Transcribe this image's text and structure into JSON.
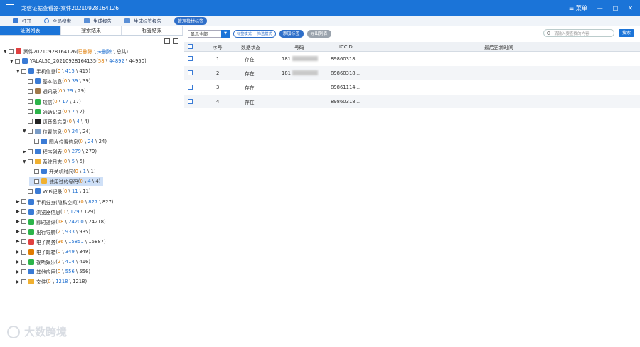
{
  "window": {
    "title": "龙信证据查看器-案件20210928164126",
    "menu_label": "菜单",
    "minimize": "—",
    "maximize": "□",
    "close": "✕"
  },
  "toolbar": {
    "items": [
      "打开",
      "全局搜索",
      "生成报告",
      "生成标签报告"
    ],
    "pill": "管理检材标签"
  },
  "left_tabs": [
    "证据列表",
    "搜索结果",
    "标签结果"
  ],
  "tree": [
    {
      "text": "案件20210928164126",
      "suffix_o": "已删除",
      "suffix_b": "未删除",
      "tail": "总共",
      "depth": 0,
      "arrow": "▼",
      "color": "#e04040"
    },
    {
      "text": "YALAL50_20210928164135",
      "n1": "58",
      "n2": "44892",
      "n3": "44950",
      "depth": 1,
      "arrow": "▼",
      "color": "#3a7bd5"
    },
    {
      "text": "手机信息",
      "n1": "0",
      "n2": "415",
      "n3": "415",
      "depth": 2,
      "arrow": "▼",
      "color": "#3a7bd5"
    },
    {
      "text": "基本信息",
      "n1": "0",
      "n2": "39",
      "n3": "39",
      "depth": 3,
      "arrow": "",
      "color": "#3a7bd5"
    },
    {
      "text": "通讯录",
      "n1": "0",
      "n2": "29",
      "n3": "29",
      "depth": 3,
      "arrow": "",
      "color": "#a0784a"
    },
    {
      "text": "短信",
      "n1": "0",
      "n2": "17",
      "n3": "17",
      "depth": 3,
      "arrow": "",
      "color": "#2cb44a"
    },
    {
      "text": "通话记录",
      "n1": "0",
      "n2": "7",
      "n3": "7",
      "depth": 3,
      "arrow": "",
      "color": "#2cb44a"
    },
    {
      "text": "语音备忘录",
      "n1": "0",
      "n2": "4",
      "n3": "4",
      "depth": 3,
      "arrow": "",
      "color": "#222222"
    },
    {
      "text": "位置信息",
      "n1": "0",
      "n2": "24",
      "n3": "24",
      "depth": 3,
      "arrow": "▼",
      "color": "#7a9cc6"
    },
    {
      "text": "图片位置信息",
      "n1": "0",
      "n2": "24",
      "n3": "24",
      "depth": 4,
      "arrow": "",
      "color": "#3a7bd5"
    },
    {
      "text": "程序列表",
      "n1": "0",
      "n2": "279",
      "n3": "279",
      "depth": 3,
      "arrow": "▶",
      "color": "#3a7bd5"
    },
    {
      "text": "系统日志",
      "n1": "0",
      "n2": "5",
      "n3": "5",
      "depth": 3,
      "arrow": "▼",
      "color": "#f0b030"
    },
    {
      "text": "开关机时间",
      "n1": "0",
      "n2": "1",
      "n3": "1",
      "depth": 4,
      "arrow": "",
      "color": "#3a7bd5"
    },
    {
      "text": "使用过的号码",
      "n1": "0",
      "n2": "4",
      "n3": "4",
      "depth": 4,
      "arrow": "",
      "color": "#f0b030",
      "selected": true
    },
    {
      "text": "WiFi记录",
      "n1": "0",
      "n2": "11",
      "n3": "11",
      "depth": 3,
      "arrow": "",
      "color": "#3a7bd5"
    },
    {
      "text": "手机分身(隐私空间)",
      "n1": "0",
      "n2": "827",
      "n3": "827",
      "depth": 2,
      "arrow": "▶",
      "color": "#3a7bd5"
    },
    {
      "text": "浏览器信息",
      "n1": "0",
      "n2": "129",
      "n3": "129",
      "depth": 2,
      "arrow": "▶",
      "color": "#3a7bd5"
    },
    {
      "text": "即时通讯",
      "n1": "18",
      "n2": "24200",
      "n3": "24218",
      "depth": 2,
      "arrow": "▶",
      "color": "#2cb44a"
    },
    {
      "text": "出行导航",
      "n1": "2",
      "n2": "933",
      "n3": "935",
      "depth": 2,
      "arrow": "▶",
      "color": "#2cb44a"
    },
    {
      "text": "电子商务",
      "n1": "36",
      "n2": "15851",
      "n3": "15887",
      "depth": 2,
      "arrow": "▶",
      "color": "#e04040"
    },
    {
      "text": "电子邮箱",
      "n1": "0",
      "n2": "349",
      "n3": "349",
      "depth": 2,
      "arrow": "▶",
      "color": "#e07b00"
    },
    {
      "text": "视听娱乐",
      "n1": "2",
      "n2": "414",
      "n3": "416",
      "depth": 2,
      "arrow": "▶",
      "color": "#2cb44a"
    },
    {
      "text": "其他应用",
      "n1": "0",
      "n2": "556",
      "n3": "556",
      "depth": 2,
      "arrow": "▶",
      "color": "#3a7bd5"
    },
    {
      "text": "文件",
      "n1": "0",
      "n2": "1218",
      "n3": "1218",
      "depth": 2,
      "arrow": "▶",
      "color": "#f0b030"
    }
  ],
  "filter": {
    "select_value": "显示全部",
    "seg_on": "标签模式",
    "seg_off": "筛选模式",
    "add_label": "添加标签",
    "export_list": "导出列表",
    "search_placeholder": "请输入要查找的内容",
    "search_btn": "搜索"
  },
  "table": {
    "headers": [
      "序号",
      "数据状态",
      "号码",
      "ICCID",
      "最后更新时间"
    ],
    "rows": [
      {
        "no": "1",
        "status": "存在",
        "number": "181",
        "iccid": "89860318..."
      },
      {
        "no": "2",
        "status": "存在",
        "number": "181",
        "iccid": "89860318..."
      },
      {
        "no": "3",
        "status": "存在",
        "number": "",
        "iccid": "89861114..."
      },
      {
        "no": "4",
        "status": "存在",
        "number": "",
        "iccid": "89860318..."
      }
    ]
  },
  "watermark": "大数跨境"
}
